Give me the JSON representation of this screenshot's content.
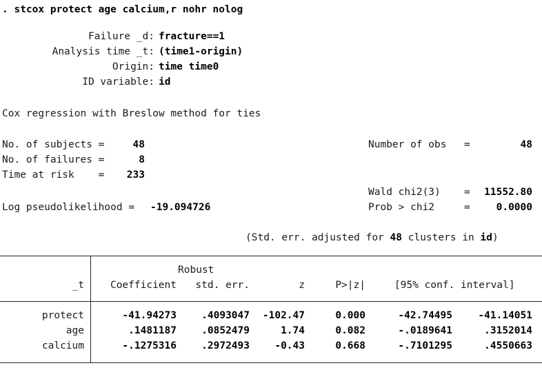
{
  "command": ". stcox protect age calcium,r nohr nolog",
  "setup": {
    "failure_label": "Failure _d:",
    "failure_value": "fracture==1",
    "analysis_label": "Analysis time _t:",
    "analysis_value": "(time1-origin)",
    "origin_label": "Origin:",
    "origin_value": "time time0",
    "id_label": "ID variable:",
    "id_value": "id"
  },
  "method_line": "Cox regression with Breslow method for ties",
  "stats": {
    "subjects_label": "No. of subjects =",
    "subjects_value": "48",
    "failures_label": "No. of failures =",
    "failures_value": "8",
    "risk_label": "Time at risk    =",
    "risk_value": "233",
    "nobs_label": "Number of obs",
    "nobs_eq": "=",
    "nobs_value": "48",
    "wald_label": "Wald chi2(3)",
    "wald_eq": "=",
    "wald_value": "11552.80",
    "prob_label": "Prob > chi2",
    "prob_eq": "=",
    "prob_value": "0.0000",
    "loglik_label": "Log pseudolikelihood =",
    "loglik_value": "-19.094726"
  },
  "cluster_note": {
    "prefix": "(Std. err. adjusted for",
    "clusters": "48",
    "middle": "clusters in",
    "var": "id",
    "suffix": ")"
  },
  "table": {
    "header_robust": "Robust",
    "headers": [
      "_t",
      "Coefficient",
      "std. err.",
      "z",
      "P>|z|",
      "[95% conf. interval]"
    ],
    "rows": [
      {
        "name": "protect",
        "coef": "-41.94273",
        "se": ".4093047",
        "z": "-102.47",
        "p": "0.000",
        "lo": "-42.74495",
        "hi": "-41.14051"
      },
      {
        "name": "age",
        "coef": ".1481187",
        "se": ".0852479",
        "z": "1.74",
        "p": "0.082",
        "lo": "-.0189641",
        "hi": ".3152014"
      },
      {
        "name": "calcium",
        "coef": "-.1275316",
        "se": ".2972493",
        "z": "-0.43",
        "p": "0.668",
        "lo": "-.7101295",
        "hi": ".4550663"
      }
    ]
  }
}
